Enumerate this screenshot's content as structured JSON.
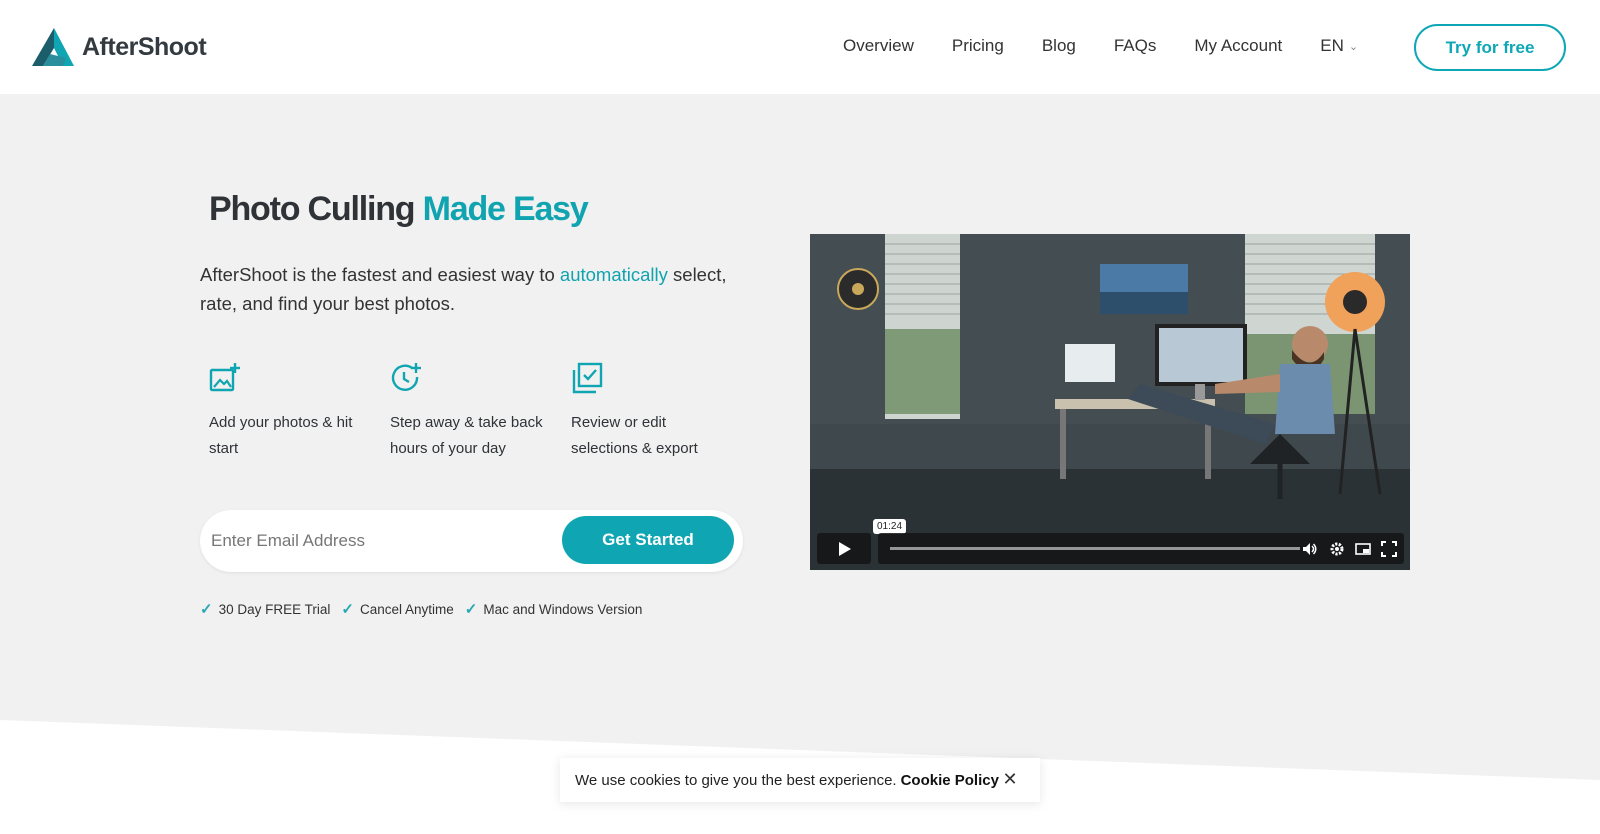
{
  "header": {
    "logo_text": "AfterShoot",
    "nav": [
      "Overview",
      "Pricing",
      "Blog",
      "FAQs",
      "My Account"
    ],
    "language": "EN",
    "cta_label": "Try for free"
  },
  "hero": {
    "title_plain": "Photo Culling",
    "title_accent": "Made Easy",
    "desc_before": "AfterShoot is the fastest and easiest way to",
    "desc_link": "automatically",
    "desc_after": "select, rate, and find your best photos.",
    "features": [
      {
        "icon": "add-photo-icon",
        "text": "Add your photos & hit start"
      },
      {
        "icon": "clock-plus-icon",
        "text": "Step away & take back hours of your day"
      },
      {
        "icon": "review-check-icon",
        "text": "Review or edit selections & export"
      }
    ],
    "email_placeholder": "Enter Email Address",
    "email_value": "",
    "get_started_label": "Get Started",
    "checks": [
      "30 Day FREE Trial",
      "Cancel Anytime",
      "Mac and Windows Version"
    ]
  },
  "video": {
    "time_tooltip": "01:24"
  },
  "cookie": {
    "text": "We use cookies to give you the best experience.",
    "link": "Cookie Policy"
  },
  "colors": {
    "accent": "#10a5b2",
    "hero_bg": "#f1f1f1",
    "text": "#2f3337"
  }
}
